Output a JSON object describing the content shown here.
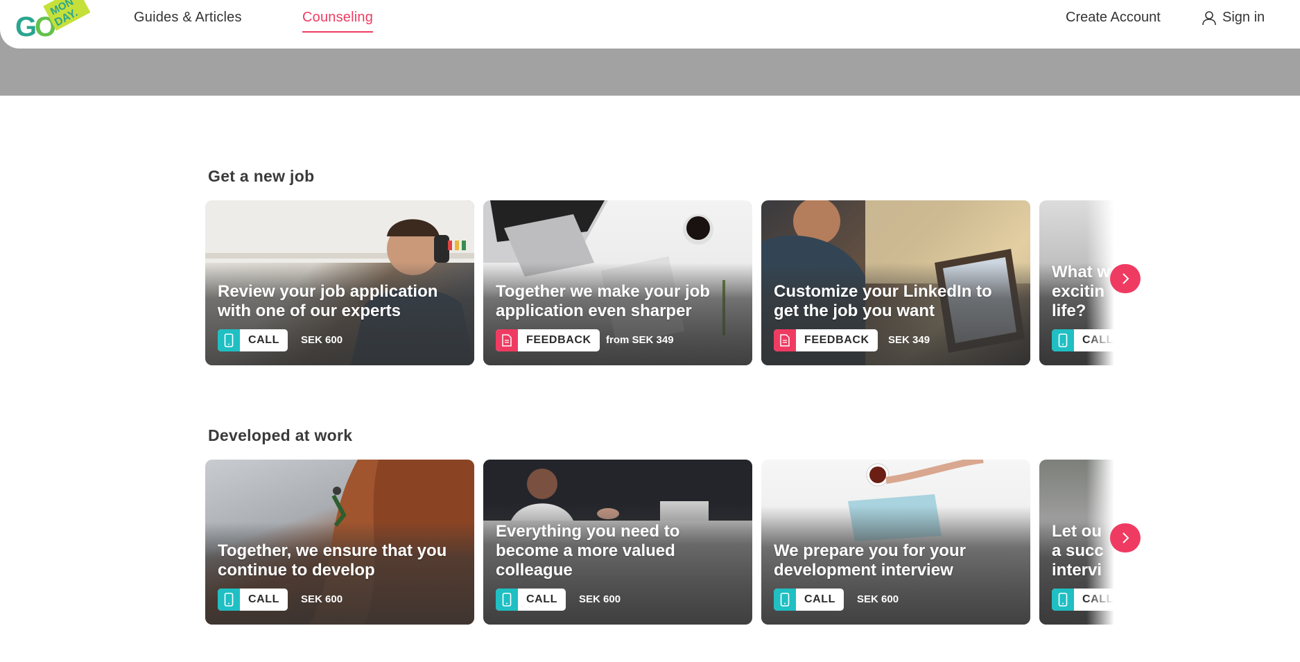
{
  "header": {
    "logo_text": "GO MONDAY.",
    "nav": [
      {
        "label": "Guides & Articles",
        "active": false
      },
      {
        "label": "Counseling",
        "active": true
      }
    ],
    "create_account": "Create Account",
    "sign_in": "Sign in"
  },
  "colors": {
    "accent": "#ef3b62",
    "call": "#1fbfc3",
    "band": "#a2a2a2"
  },
  "sections": [
    {
      "title": "Get a new job",
      "cards": [
        {
          "title": "Review your job application with one of our experts",
          "badge": "CALL",
          "badge_icon": "phone-icon",
          "price": "SEK 600"
        },
        {
          "title": "Together we make your job application even sharper",
          "badge": "FEEDBACK",
          "badge_icon": "document-icon",
          "price": "from  SEK 349"
        },
        {
          "title": "Customize your LinkedIn to get the job you want",
          "badge": "FEEDBACK",
          "badge_icon": "document-icon",
          "price": "SEK 349"
        },
        {
          "title": "What w\nexcitin\nlife?",
          "badge": "CALL",
          "badge_icon": "phone-icon",
          "price": ""
        }
      ]
    },
    {
      "title": "Developed at work",
      "cards": [
        {
          "title": "Together, we ensure that you continue to develop",
          "badge": "CALL",
          "badge_icon": "phone-icon",
          "price": "SEK 600"
        },
        {
          "title": "Everything you need to become a more valued colleague",
          "badge": "CALL",
          "badge_icon": "phone-icon",
          "price": "SEK 600"
        },
        {
          "title": "We prepare you for your development interview",
          "badge": "CALL",
          "badge_icon": "phone-icon",
          "price": "SEK 600"
        },
        {
          "title": "Let ou\na succ\nintervi",
          "badge": "CALL",
          "badge_icon": "phone-icon",
          "price": ""
        }
      ]
    }
  ]
}
